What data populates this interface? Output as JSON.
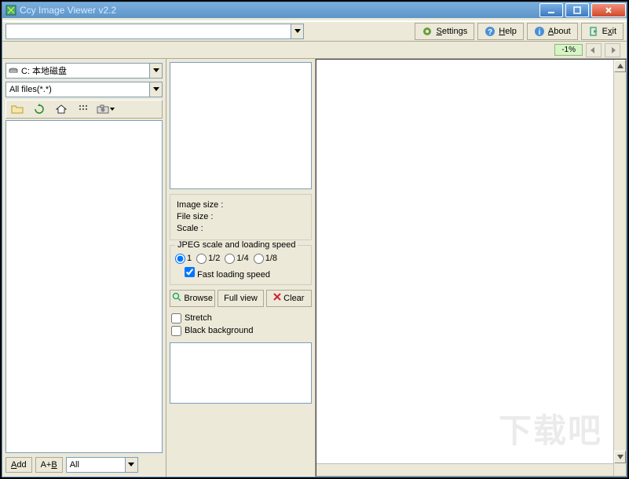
{
  "window": {
    "title": "Ccy Image Viewer v2.2"
  },
  "toolbar": {
    "settings": "Settings",
    "help": "Help",
    "about": "About",
    "exit": "Exit"
  },
  "zoom": {
    "value": "-1%"
  },
  "drive": {
    "selected": "C: 本地磁盘"
  },
  "filter": {
    "selected": "All files(*.*)"
  },
  "bottom": {
    "add": "Add",
    "ab": "A+B",
    "all": "All"
  },
  "info": {
    "image_size_label": "Image size :",
    "file_size_label": "File size :",
    "scale_label": "Scale :"
  },
  "jpeg": {
    "legend": "JPEG scale and loading speed",
    "r1": "1",
    "r2": "1/2",
    "r3": "1/4",
    "r4": "1/8",
    "fast": "Fast loading speed"
  },
  "actions": {
    "browse": "Browse",
    "fullview": "Full view",
    "clear": "Clear"
  },
  "options": {
    "stretch": "Stretch",
    "blackbg": "Black background"
  }
}
